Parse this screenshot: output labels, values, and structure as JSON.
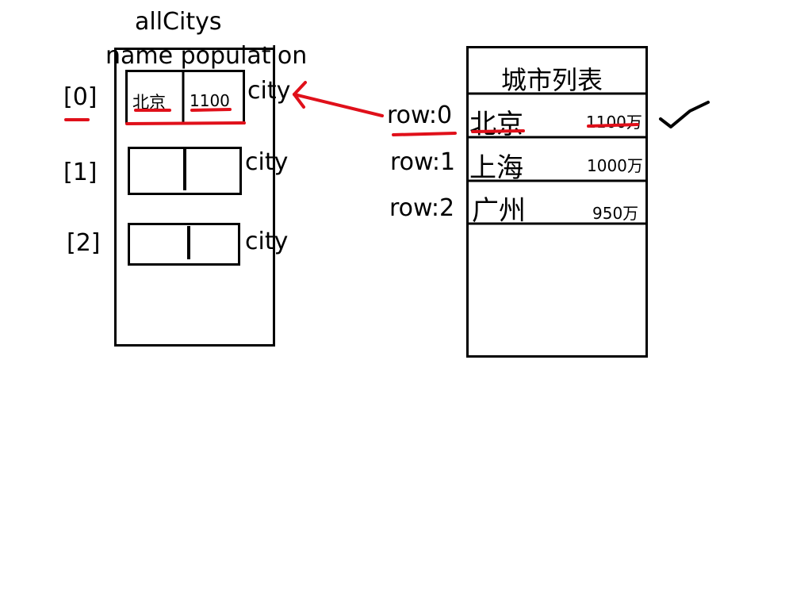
{
  "left": {
    "title": "allCitys",
    "header": "name population",
    "index_labels": [
      "[0]",
      "[1]",
      "[2]"
    ],
    "item_label": "city",
    "first_item": {
      "name": "北京",
      "population": "1100"
    }
  },
  "right": {
    "title": "城市列表",
    "rows": [
      {
        "row_label": "row:0",
        "name": "北京",
        "population": "1100万"
      },
      {
        "row_label": "row:1",
        "name": "上海",
        "population": "1000万"
      },
      {
        "row_label": "row:2",
        "name": "广州",
        "population": "950万"
      }
    ]
  },
  "colors": {
    "ink": "#000000",
    "highlight": "#e0101a"
  }
}
